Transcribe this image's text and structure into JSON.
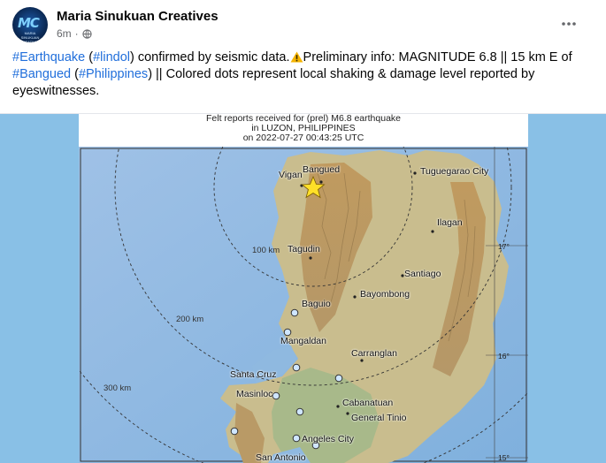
{
  "post": {
    "page_name": "Maria Sinukuan Creatives",
    "time": "6m",
    "privacy_separator": "·",
    "more_icon": "more-horizontal-icon",
    "avatar_text": "MC",
    "avatar_subtext": "MARIA SINUKUAN CREATIVES",
    "text": {
      "tag_earthquake": "#Earthquake",
      "open_paren": " (",
      "tag_lindol": "#lindol",
      "part1": ") confirmed by seismic data.",
      "part2": "Preliminary info: MAGNITUDE 6.8 || 15 km E of",
      "tag_bangued": "#Bangued",
      "open_paren2": " (",
      "tag_philippines": "#Philippines",
      "part3": ") || Colored dots represent local shaking & damage level reported by",
      "part4": "eyeswitnesses."
    }
  },
  "map": {
    "caption_line1": "Felt reports received for (prel) M6.8 earthquake",
    "caption_line2": "in LUZON, PHILIPPINES",
    "caption_line3": "on  2022-07-27 00:43:25 UTC",
    "places": {
      "vigan": "Vigan",
      "bangued": "Bangued",
      "tuguegarao": "Tuguegarao City",
      "ilagan": "Ilagan",
      "tagudin": "Tagudin",
      "santiago": "Santiago",
      "bayombong": "Bayombong",
      "baguio": "Baguio",
      "mangaldan": "Mangaldan",
      "carranglan": "Carranglan",
      "santa_cruz": "Santa Cruz",
      "masinloc": "Masinloc",
      "cabanatuan": "Cabanatuan",
      "general_tinio": "General Tinio",
      "angeles": "Angeles City",
      "san_antonio": "San Antonio"
    },
    "rings": {
      "r100": "100 km",
      "r200": "200 km",
      "r300": "300 km"
    },
    "lat": {
      "l17": "17°",
      "l16": "16°",
      "l15": "15°"
    },
    "colors": {
      "water": "#a7c5e6",
      "land": "#c7b98a",
      "dot": "#cfe6ff",
      "star": "#ffe028"
    }
  }
}
